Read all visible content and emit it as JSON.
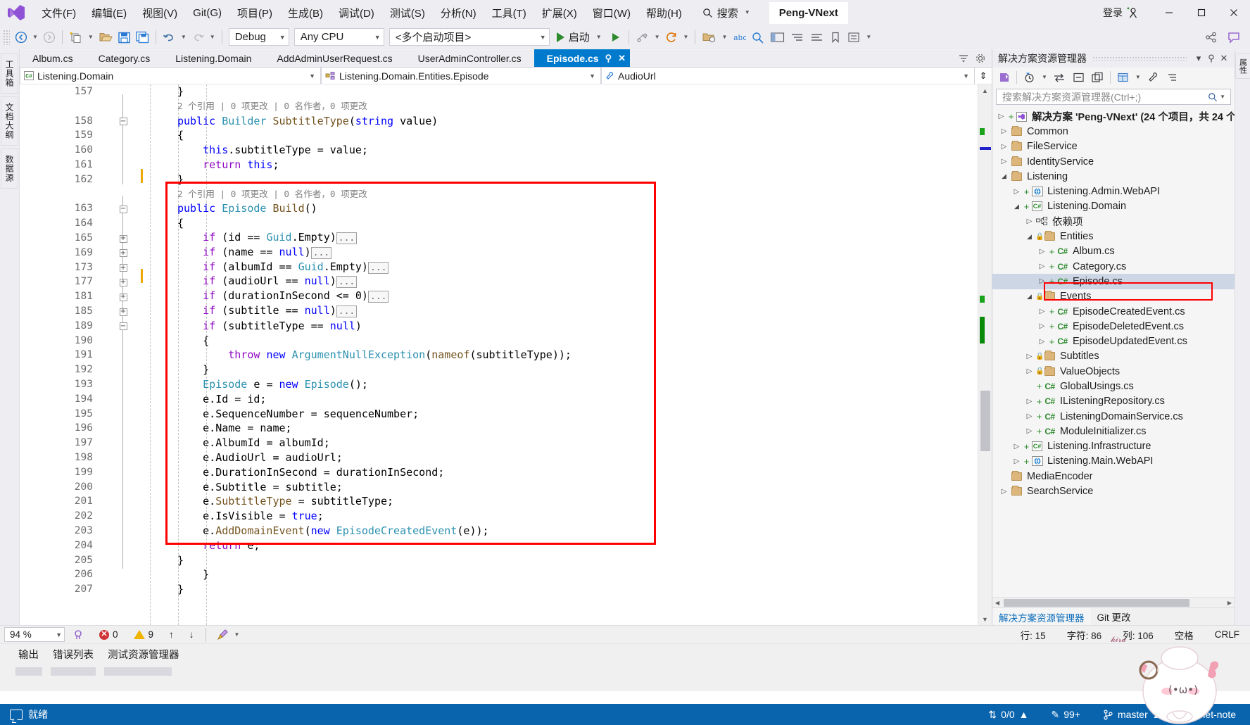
{
  "app": {
    "title": "Peng-VNext",
    "signin_label": "登录"
  },
  "menu": {
    "items": [
      {
        "label": "文件(F)",
        "name": "menu-file"
      },
      {
        "label": "编辑(E)",
        "name": "menu-edit"
      },
      {
        "label": "视图(V)",
        "name": "menu-view"
      },
      {
        "label": "Git(G)",
        "name": "menu-git"
      },
      {
        "label": "项目(P)",
        "name": "menu-project"
      },
      {
        "label": "生成(B)",
        "name": "menu-build"
      },
      {
        "label": "调试(D)",
        "name": "menu-debug"
      },
      {
        "label": "测试(S)",
        "name": "menu-test"
      },
      {
        "label": "分析(N)",
        "name": "menu-analyze"
      },
      {
        "label": "工具(T)",
        "name": "menu-tools"
      },
      {
        "label": "扩展(X)",
        "name": "menu-extensions"
      },
      {
        "label": "窗口(W)",
        "name": "menu-window"
      },
      {
        "label": "帮助(H)",
        "name": "menu-help"
      }
    ],
    "search_label": "搜索"
  },
  "window_buttons": {
    "minimize": "—",
    "maximize": "□",
    "close": "✕"
  },
  "toolbar": {
    "configuration": "Debug",
    "platform": "Any CPU",
    "startup_project": "<多个启动项目>",
    "run_label": "启动"
  },
  "tabs": {
    "items": [
      {
        "label": "Album.cs",
        "active": false
      },
      {
        "label": "Category.cs",
        "active": false
      },
      {
        "label": "Listening.Domain",
        "active": false
      },
      {
        "label": "AddAdminUserRequest.cs",
        "active": false
      },
      {
        "label": "UserAdminController.cs",
        "active": false
      },
      {
        "label": "Episode.cs",
        "active": true
      }
    ]
  },
  "navbar": {
    "project": "Listening.Domain",
    "type": "Listening.Domain.Entities.Episode",
    "member": "AudioUrl"
  },
  "left_rail": {
    "tabs": [
      "工具箱",
      "文档大纲",
      "数据源"
    ]
  },
  "right_rail": {
    "tabs": [
      "属性"
    ]
  },
  "editor": {
    "zoom": "94 %",
    "error_count": "0",
    "warning_count": "9",
    "line_label": "行: 15",
    "char_label": "字符: 86",
    "col_label": "列: 106",
    "indent_label": "空格",
    "eol_label": "CRLF",
    "lines": [
      {
        "num": "157",
        "fold": "",
        "text": "        }",
        "tokens": [
          {
            "t": "        }",
            "c": "n"
          }
        ]
      },
      {
        "num": "",
        "fold": "",
        "text": "",
        "codelens": "2 个引用 | 0 项更改 | 0 名作者，0 项更改"
      },
      {
        "num": "158",
        "fold": "-",
        "text": "        public Builder SubtitleType(string value)"
      },
      {
        "num": "159",
        "fold": "",
        "text": "        {"
      },
      {
        "num": "160",
        "fold": "",
        "text": "            this.subtitleType = value;"
      },
      {
        "num": "161",
        "fold": "",
        "text": "            return this;"
      },
      {
        "num": "162",
        "fold": "",
        "text": "        }"
      },
      {
        "num": "",
        "fold": "",
        "text": "",
        "codelens": "2 个引用 | 0 项更改 | 0 名作者，0 项更改"
      },
      {
        "num": "163",
        "fold": "-",
        "text": "        public Episode Build()"
      },
      {
        "num": "164",
        "fold": "",
        "text": "        {"
      },
      {
        "num": "165",
        "fold": "+",
        "text": "            if (id == Guid.Empty)..."
      },
      {
        "num": "169",
        "fold": "+",
        "text": "            if (name == null)..."
      },
      {
        "num": "173",
        "fold": "+",
        "text": "            if (albumId == Guid.Empty)..."
      },
      {
        "num": "177",
        "fold": "+",
        "text": "            if (audioUrl == null)..."
      },
      {
        "num": "181",
        "fold": "+",
        "text": "            if (durationInSecond <= 0)..."
      },
      {
        "num": "185",
        "fold": "+",
        "text": "            if (subtitle == null)..."
      },
      {
        "num": "189",
        "fold": "-",
        "text": "            if (subtitleType == null)"
      },
      {
        "num": "190",
        "fold": "",
        "text": "            {"
      },
      {
        "num": "191",
        "fold": "",
        "text": "                throw new ArgumentNullException(nameof(subtitleType));"
      },
      {
        "num": "192",
        "fold": "",
        "text": "            }"
      },
      {
        "num": "193",
        "fold": "",
        "text": "            Episode e = new Episode();"
      },
      {
        "num": "194",
        "fold": "",
        "text": "            e.Id = id;"
      },
      {
        "num": "195",
        "fold": "",
        "text": "            e.SequenceNumber = sequenceNumber;"
      },
      {
        "num": "196",
        "fold": "",
        "text": "            e.Name = name;"
      },
      {
        "num": "197",
        "fold": "",
        "text": "            e.AlbumId = albumId;"
      },
      {
        "num": "198",
        "fold": "",
        "text": "            e.AudioUrl = audioUrl;"
      },
      {
        "num": "199",
        "fold": "",
        "text": "            e.DurationInSecond = durationInSecond;"
      },
      {
        "num": "200",
        "fold": "",
        "text": "            e.Subtitle = subtitle;"
      },
      {
        "num": "201",
        "fold": "",
        "text": "            e.SubtitleType = subtitleType;"
      },
      {
        "num": "202",
        "fold": "",
        "text": "            e.IsVisible = true;"
      },
      {
        "num": "203",
        "fold": "",
        "text": "            e.AddDomainEvent(new EpisodeCreatedEvent(e));"
      },
      {
        "num": "204",
        "fold": "",
        "text": "            return e;"
      },
      {
        "num": "205",
        "fold": "",
        "text": "        }"
      },
      {
        "num": "206",
        "fold": "",
        "text": "    }"
      },
      {
        "num": "207",
        "fold": "",
        "text": "}"
      }
    ]
  },
  "solution_explorer": {
    "title": "解决方案资源管理器",
    "search_placeholder": "搜索解决方案资源管理器(Ctrl+;)",
    "root": "解决方案 'Peng-VNext' (24 个项目，共 24 个",
    "tree": [
      {
        "label": "Common",
        "depth": 0,
        "arrow": "▷",
        "icon": "folder",
        "plus": false,
        "lock": false
      },
      {
        "label": "FileService",
        "depth": 0,
        "arrow": "▷",
        "icon": "folder",
        "plus": false,
        "lock": false
      },
      {
        "label": "IdentityService",
        "depth": 0,
        "arrow": "▷",
        "icon": "folder",
        "plus": false,
        "lock": false
      },
      {
        "label": "Listening",
        "depth": 0,
        "arrow": "▼",
        "icon": "folder",
        "plus": false,
        "lock": false
      },
      {
        "label": "Listening.Admin.WebAPI",
        "depth": 1,
        "arrow": "▷",
        "icon": "web",
        "plus": true,
        "lock": false
      },
      {
        "label": "Listening.Domain",
        "depth": 1,
        "arrow": "▼",
        "icon": "csproj",
        "plus": true,
        "lock": false
      },
      {
        "label": "依赖项",
        "depth": 2,
        "arrow": "▷",
        "icon": "deps",
        "plus": false,
        "lock": false
      },
      {
        "label": "Entities",
        "depth": 2,
        "arrow": "▼",
        "icon": "folder",
        "plus": false,
        "lock": true
      },
      {
        "label": "Album.cs",
        "depth": 3,
        "arrow": "▷",
        "icon": "cs",
        "plus": true,
        "lock": false
      },
      {
        "label": "Category.cs",
        "depth": 3,
        "arrow": "▷",
        "icon": "cs",
        "plus": true,
        "lock": false
      },
      {
        "label": "Episode.cs",
        "depth": 3,
        "arrow": "▷",
        "icon": "cs",
        "plus": true,
        "lock": false,
        "selected": true,
        "highlight": true
      },
      {
        "label": "Events",
        "depth": 2,
        "arrow": "▼",
        "icon": "folder",
        "plus": false,
        "lock": true
      },
      {
        "label": "EpisodeCreatedEvent.cs",
        "depth": 3,
        "arrow": "▷",
        "icon": "cs",
        "plus": true,
        "lock": false
      },
      {
        "label": "EpisodeDeletedEvent.cs",
        "depth": 3,
        "arrow": "▷",
        "icon": "cs",
        "plus": true,
        "lock": false
      },
      {
        "label": "EpisodeUpdatedEvent.cs",
        "depth": 3,
        "arrow": "▷",
        "icon": "cs",
        "plus": true,
        "lock": false
      },
      {
        "label": "Subtitles",
        "depth": 2,
        "arrow": "▷",
        "icon": "folder",
        "plus": false,
        "lock": true
      },
      {
        "label": "ValueObjects",
        "depth": 2,
        "arrow": "▷",
        "icon": "folder",
        "plus": false,
        "lock": true
      },
      {
        "label": "GlobalUsings.cs",
        "depth": 2,
        "arrow": "",
        "icon": "cs",
        "plus": true,
        "lock": false
      },
      {
        "label": "IListeningRepository.cs",
        "depth": 2,
        "arrow": "▷",
        "icon": "cs",
        "plus": true,
        "lock": false
      },
      {
        "label": "ListeningDomainService.cs",
        "depth": 2,
        "arrow": "▷",
        "icon": "cs",
        "plus": true,
        "lock": false
      },
      {
        "label": "ModuleInitializer.cs",
        "depth": 2,
        "arrow": "▷",
        "icon": "cs",
        "plus": true,
        "lock": false
      },
      {
        "label": "Listening.Infrastructure",
        "depth": 1,
        "arrow": "▷",
        "icon": "csproj",
        "plus": true,
        "lock": false
      },
      {
        "label": "Listening.Main.WebAPI",
        "depth": 1,
        "arrow": "▷",
        "icon": "web",
        "plus": true,
        "lock": false
      },
      {
        "label": "MediaEncoder",
        "depth": 0,
        "arrow": "",
        "icon": "folder",
        "plus": false,
        "lock": false
      },
      {
        "label": "SearchService",
        "depth": 0,
        "arrow": "▷",
        "icon": "folder",
        "plus": false,
        "lock": false
      }
    ],
    "tabs": [
      {
        "label": "解决方案资源管理器",
        "active": true
      },
      {
        "label": "Git 更改",
        "active": false
      }
    ]
  },
  "bottom_panels": {
    "tabs": [
      "输出",
      "错误列表",
      "测试资源管理器"
    ]
  },
  "statusbar": {
    "ready": "就绪",
    "sync": "0/0",
    "pending_changes": "99+",
    "branch": "master",
    "repo": "net-note",
    "colors": {
      "bar": "#0a64ad"
    }
  }
}
